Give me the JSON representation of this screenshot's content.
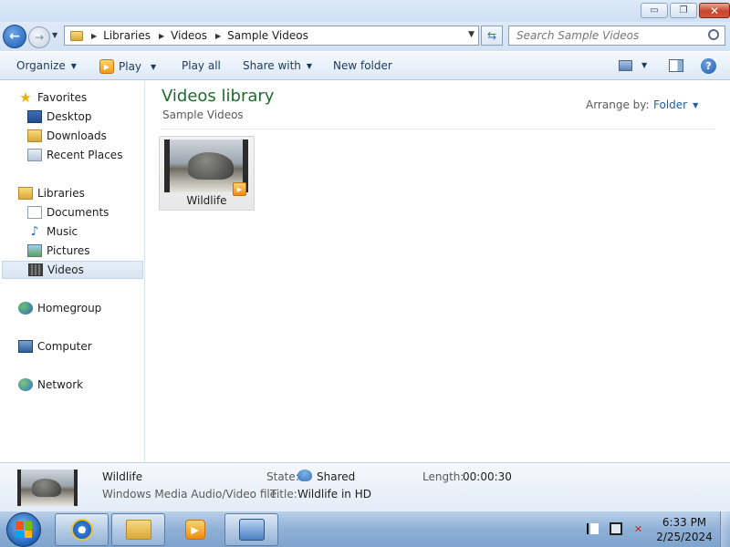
{
  "window": {
    "min_label": "▭",
    "max_label": "❐",
    "close_label": "✕"
  },
  "address": {
    "crumbs": [
      "Libraries",
      "Videos",
      "Sample Videos"
    ],
    "search_placeholder": "Search Sample Videos"
  },
  "toolbar": {
    "organize": "Organize",
    "play": "Play",
    "play_all": "Play all",
    "share_with": "Share with",
    "new_folder": "New folder"
  },
  "nav": {
    "favorites": "Favorites",
    "desktop": "Desktop",
    "downloads": "Downloads",
    "recent_places": "Recent Places",
    "libraries": "Libraries",
    "documents": "Documents",
    "music": "Music",
    "pictures": "Pictures",
    "videos": "Videos",
    "homegroup": "Homegroup",
    "computer": "Computer",
    "network": "Network"
  },
  "content": {
    "title": "Videos library",
    "subtitle": "Sample Videos",
    "arrange_label": "Arrange by:",
    "arrange_value": "Folder",
    "items": [
      {
        "name": "Wildlife"
      }
    ]
  },
  "details": {
    "name": "Wildlife",
    "type": "Windows Media Audio/Video file",
    "state_label": "State:",
    "state_value": "Shared",
    "title_label": "Title:",
    "title_value": "Wildlife in HD",
    "length_label": "Length:",
    "length_value": "00:00:30"
  },
  "taskbar": {
    "time": "6:33 PM",
    "date": "2/25/2024"
  },
  "colors": {
    "library_title": "#1e6b2e",
    "link_blue": "#1e5fa8",
    "close_red": "#c9452d"
  },
  "icons": [
    "back-icon",
    "forward-icon",
    "folder-icon",
    "refresh-icon",
    "search-icon",
    "play-icon",
    "view-icon",
    "preview-pane-icon",
    "help-icon",
    "star-icon",
    "desktop-icon",
    "downloads-icon",
    "recent-places-icon",
    "libraries-icon",
    "documents-icon",
    "music-icon",
    "pictures-icon",
    "videos-icon",
    "homegroup-icon",
    "computer-icon",
    "network-icon",
    "shared-icon",
    "start-orb-icon",
    "ie-icon",
    "explorer-icon",
    "media-player-icon",
    "remote-desktop-icon",
    "action-center-icon",
    "network-tray-icon",
    "volume-muted-icon"
  ]
}
